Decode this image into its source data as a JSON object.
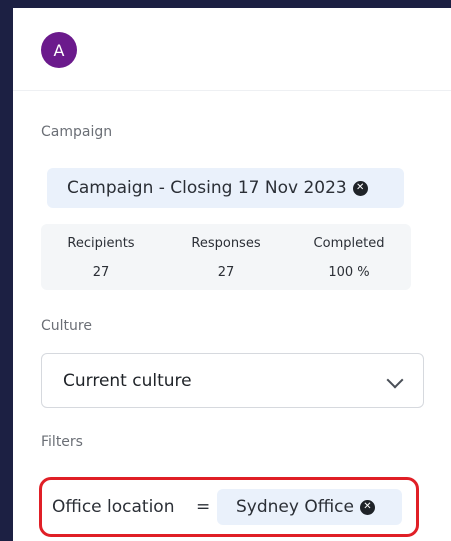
{
  "user": {
    "avatar_initial": "A",
    "avatar_color": "#6b1a8c"
  },
  "campaign": {
    "label": "Campaign",
    "selected": "Campaign - Closing 17 Nov 2023",
    "remove_icon": "close-circle-icon",
    "stats": [
      {
        "label": "Recipients",
        "value": "27"
      },
      {
        "label": "Responses",
        "value": "27"
      },
      {
        "label": "Completed",
        "value": "100 %"
      }
    ]
  },
  "culture": {
    "label": "Culture",
    "selected": "Current culture",
    "chevron_icon": "chevron-down-icon"
  },
  "filters": {
    "label": "Filters",
    "items": [
      {
        "key": "Office location",
        "operator": "=",
        "value": "Sydney Office",
        "highlight_color": "#e01f26"
      }
    ]
  },
  "colors": {
    "background": "#1c2043",
    "chip": "#eaf1fb",
    "highlight": "#e01f26"
  }
}
